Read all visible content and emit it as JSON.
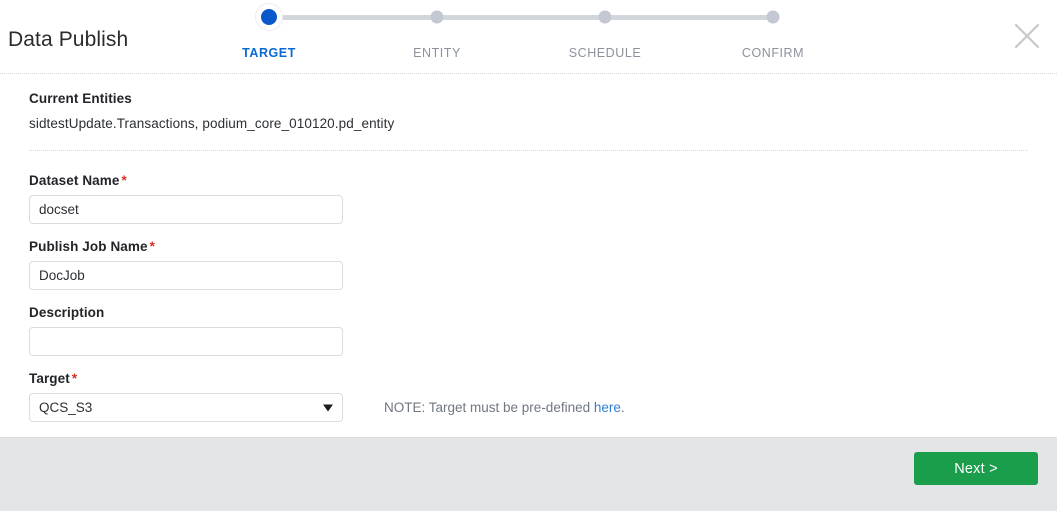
{
  "header": {
    "title": "Data Publish",
    "close_icon": "close-icon"
  },
  "stepper": {
    "steps": [
      {
        "label": "TARGET",
        "state": "active"
      },
      {
        "label": "ENTITY",
        "state": "inactive"
      },
      {
        "label": "SCHEDULE",
        "state": "inactive"
      },
      {
        "label": "CONFIRM",
        "state": "inactive"
      }
    ],
    "active_color": "#0b6ad0",
    "inactive_color": "#8c929c",
    "track_color": "#d2d6dd"
  },
  "entities": {
    "heading": "Current Entities",
    "value": "sidtestUpdate.Transactions, podium_core_010120.pd_entity"
  },
  "form": {
    "dataset_name": {
      "label": "Dataset Name",
      "required_marker": "*",
      "value": "docset",
      "placeholder": ""
    },
    "publish_job_name": {
      "label": "Publish Job Name",
      "required_marker": "*",
      "value": "DocJob",
      "placeholder": ""
    },
    "description": {
      "label": "Description",
      "value": "",
      "placeholder": ""
    },
    "target": {
      "label": "Target",
      "required_marker": "*",
      "value": "QCS_S3",
      "options": [
        "QCS_S3"
      ],
      "caret_icon": "chevron-down-icon"
    },
    "note": {
      "prefix": "NOTE: Target must be pre-defined ",
      "link_text": "here",
      "suffix": "."
    }
  },
  "footer": {
    "next_label": "Next >",
    "next_color": "#1b9e4b",
    "background": "#e4e5e6"
  }
}
